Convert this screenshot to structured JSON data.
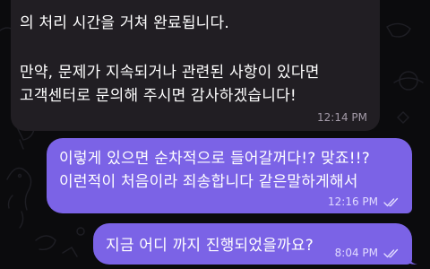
{
  "incoming_message": {
    "lines": [
      "의 처리 시간을 거쳐 완료됩니다.",
      "만약, 문제가 지속되거나 관련된 사항이 있다면",
      "고객센터로 문의해 주시면 감사하겠습니다!"
    ],
    "time": "12:14 PM"
  },
  "outgoing_messages": [
    {
      "lines": [
        "이렇게 있으면 순차적으로 들어갈꺼다!? 맞죠!!?",
        "이런적이 처음이라 죄송합니다 같은말하게해서"
      ],
      "time": "12:16 PM",
      "read_icon": "double-check-icon"
    },
    {
      "lines": [
        "지금 어디 까지 진행되었을까요?"
      ],
      "time": "8:04 PM",
      "read_icon": "double-check-icon"
    }
  ],
  "colors": {
    "background": "#0b0b0d",
    "incoming_bubble": "#211e23",
    "outgoing_bubble": "#7b63e6"
  }
}
